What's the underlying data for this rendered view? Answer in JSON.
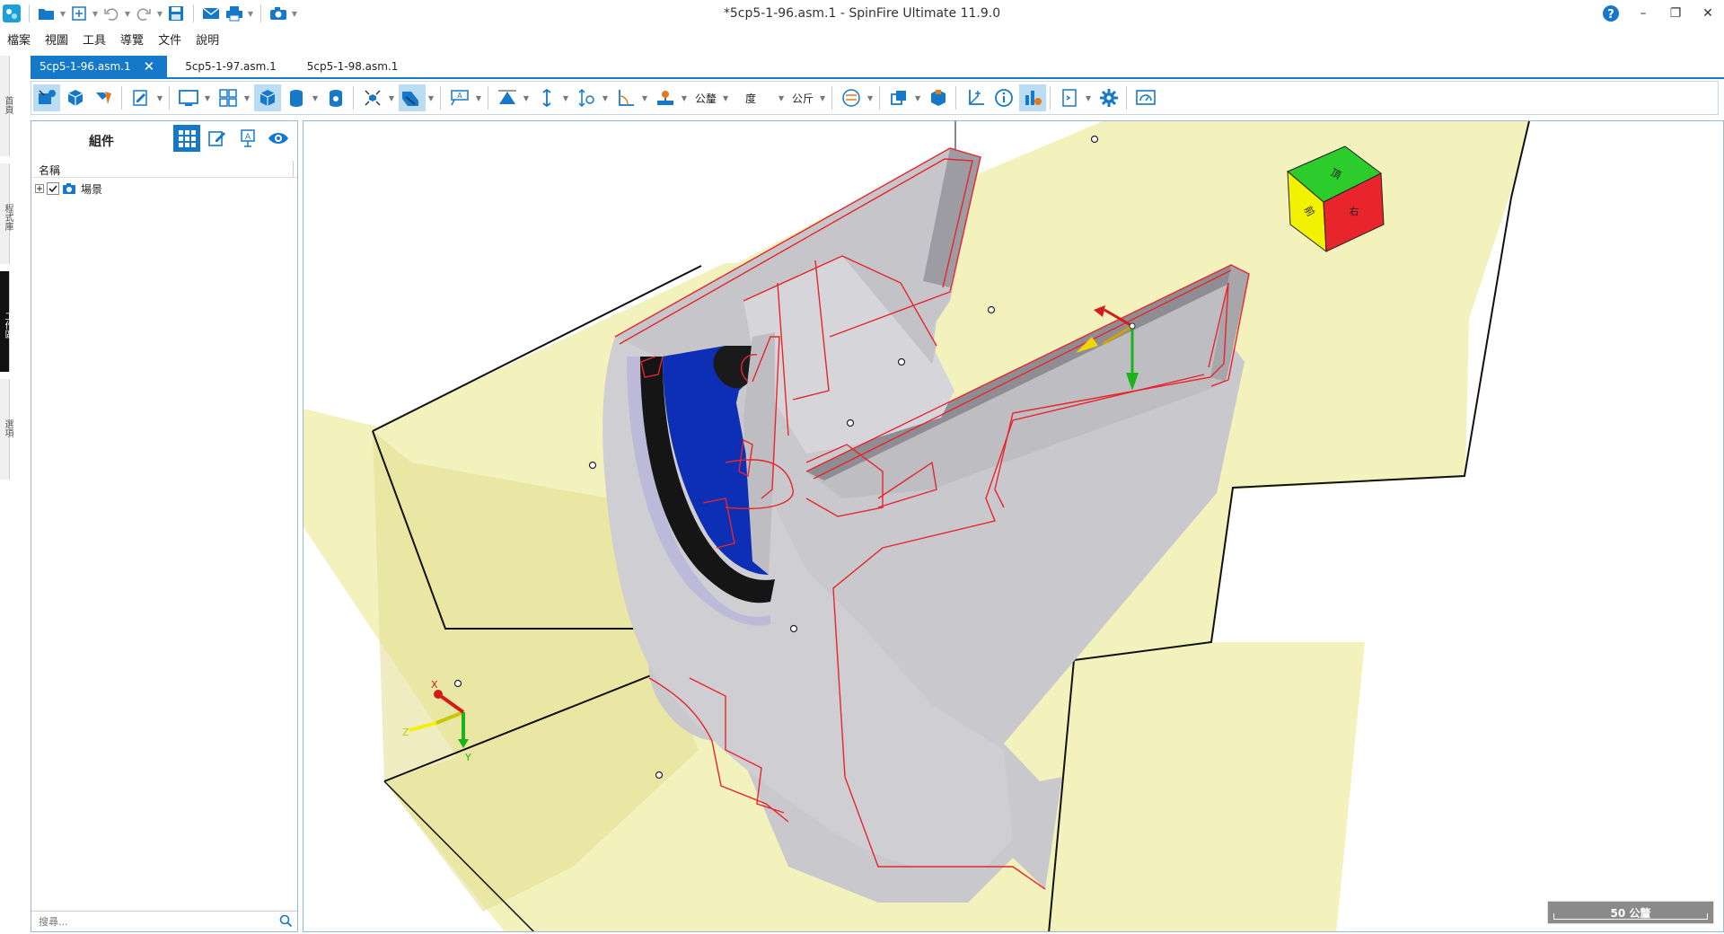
{
  "window": {
    "title": "*5cp5-1-96.asm.1 - SpinFire Ultimate 11.9.0",
    "help_label": "?",
    "minimize_label": "–",
    "restore_label": "❐",
    "close_label": "✕"
  },
  "menu": [
    "檔案",
    "視圖",
    "工具",
    "導覽",
    "文件",
    "說明"
  ],
  "doc_tabs": [
    {
      "label": "5cp5-1-96.asm.1",
      "active": true
    },
    {
      "label": "5cp5-1-97.asm.1",
      "active": false
    },
    {
      "label": "5cp5-1-98.asm.1",
      "active": false
    }
  ],
  "side_tabs": [
    "首頁",
    "程式庫",
    "工作區",
    "選項"
  ],
  "toolbar": {
    "units_length": "公釐",
    "units_angle": "度",
    "units_mass": "公斤"
  },
  "panel": {
    "title": "組件",
    "column_name": "名稱",
    "tree_root": "場景",
    "search_placeholder": "搜尋..."
  },
  "viewport": {
    "scale_label": "50 公釐",
    "axis_x": "X",
    "axis_y": "Y",
    "axis_z": "Z",
    "cube_top": "頂",
    "cube_front": "前",
    "cube_right": "右"
  },
  "colors": {
    "accent": "#1678c8",
    "plane": "#f3f0b4",
    "part_section_edge": "#e8242c",
    "part_gray": "#c9c9cd",
    "blue_face": "#0d2fb5"
  }
}
